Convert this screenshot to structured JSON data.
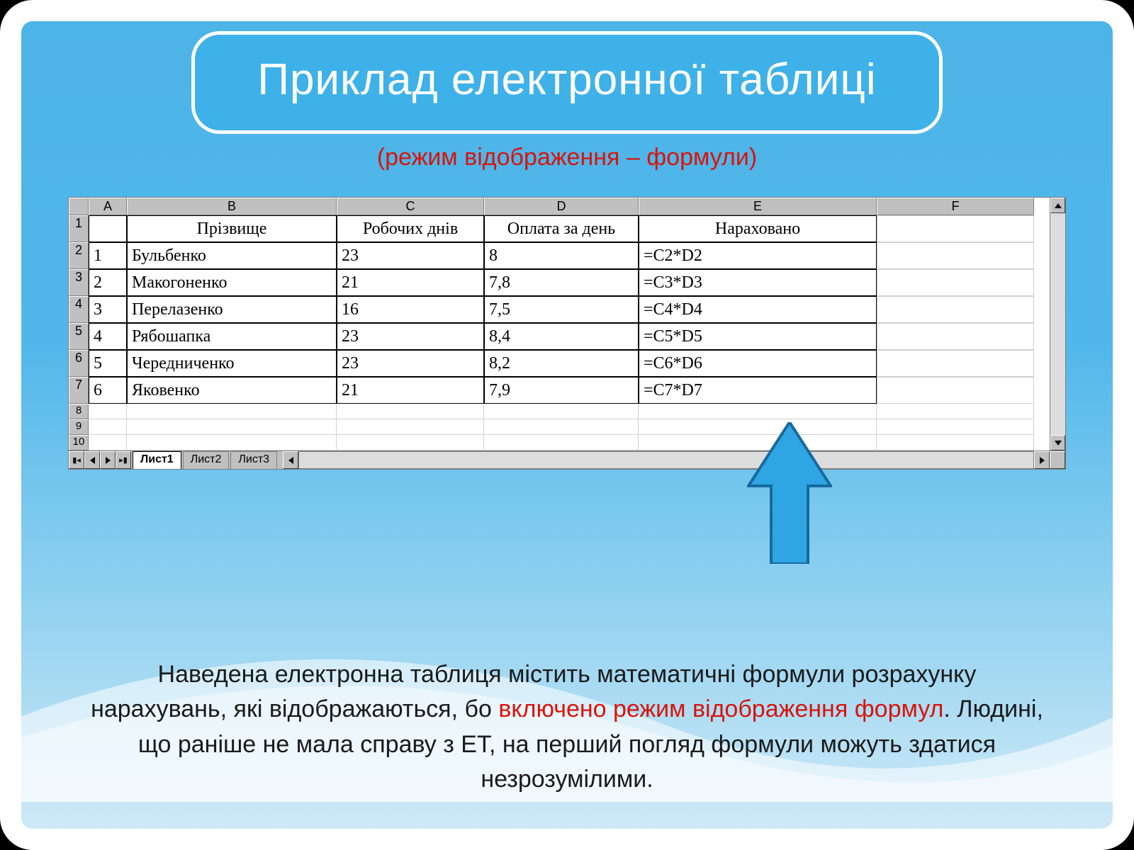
{
  "title": "Приклад електронної таблиці",
  "subtitle": "(режим відображення – формули)",
  "columns": [
    "A",
    "B",
    "C",
    "D",
    "E",
    "F"
  ],
  "header_row": {
    "num": "1",
    "a": "",
    "b": "Прізвище",
    "c": "Робочих днів",
    "d": "Оплата за день",
    "e": "Нараховано",
    "f": ""
  },
  "rows": [
    {
      "num": "2",
      "a": "1",
      "b": "Бульбенко",
      "c": "23",
      "d": "8",
      "e": "=C2*D2"
    },
    {
      "num": "3",
      "a": "2",
      "b": "Макогоненко",
      "c": "21",
      "d": "7,8",
      "e": "=C3*D3"
    },
    {
      "num": "4",
      "a": "3",
      "b": "Перелазенко",
      "c": "16",
      "d": "7,5",
      "e": "=C4*D4"
    },
    {
      "num": "5",
      "a": "4",
      "b": "Рябошапка",
      "c": "23",
      "d": "8,4",
      "e": "=C5*D5"
    },
    {
      "num": "6",
      "a": "5",
      "b": "Чередниченко",
      "c": "23",
      "d": "8,2",
      "e": "=C6*D6"
    },
    {
      "num": "7",
      "a": "6",
      "b": "Яковенко",
      "c": "21",
      "d": "7,9",
      "e": "=C7*D7"
    }
  ],
  "empty_rows": [
    "8",
    "9",
    "10"
  ],
  "sheet_tabs": {
    "active": "Лист1",
    "others": [
      "Лист2",
      "Лист3"
    ]
  },
  "caption": {
    "p1": "Наведена електронна таблиця містить математичні формули розрахунку нарахувань, які відображаються, бо ",
    "em": "включено режим відображення формул",
    "p2": ". Людині, що раніше не мала справу з ЕТ, на перший погляд формули можуть здатися незрозумілими."
  }
}
